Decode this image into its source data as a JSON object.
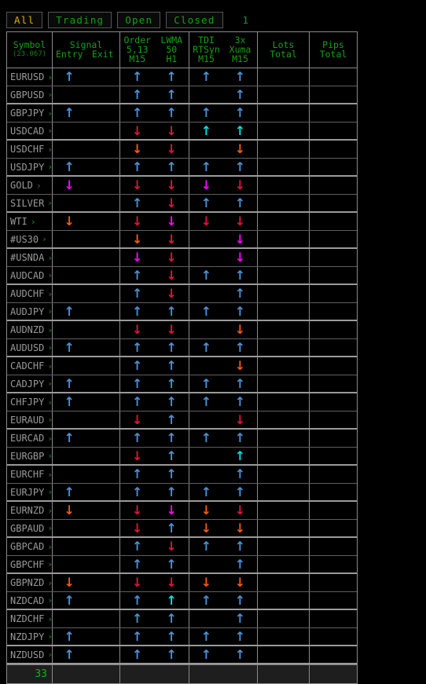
{
  "filters": {
    "buttons": [
      {
        "label": "All",
        "selected": true
      },
      {
        "label": "Trading",
        "selected": false
      },
      {
        "label": "Open",
        "selected": false
      },
      {
        "label": "Closed",
        "selected": false
      }
    ],
    "count": "1"
  },
  "colors": {
    "green": "#15a015",
    "yellow": "#d8b000",
    "symbol": "#9a9a9a",
    "up_blue": "#4a90d9",
    "up_cyan": "#00e0e0",
    "down_red": "#e2123f",
    "down_orange": "#f35a0a",
    "down_magenta": "#ff00ff",
    "border": "#8a8a8a",
    "background": "#000000",
    "footer_bg": "#1e1e1e"
  },
  "table": {
    "headers": [
      {
        "name": "symbol",
        "line1": "Symbol",
        "line2": "(23.067)"
      },
      {
        "name": "signal",
        "line1": "Signal",
        "sub_a": "Entry",
        "sub_b": "Exit"
      },
      {
        "name": "order-lwma",
        "a1": "Order",
        "a2": "5,13",
        "a3": "M15",
        "b1": "LWMA",
        "b2": "50",
        "b3": "H1"
      },
      {
        "name": "tdi-xuma",
        "a1": "TDI",
        "a2": "RTSyn",
        "a3": "M15",
        "b1": "3x",
        "b2": "Xuma",
        "b3": "M15"
      },
      {
        "name": "lots",
        "line1": "Lots",
        "line2": "Total"
      },
      {
        "name": "pips",
        "line1": "Pips",
        "line2": "Total"
      }
    ],
    "rows": [
      {
        "symbol": "EURUSD",
        "group_end": false,
        "signal_entry": "up-blue",
        "signal_exit": "",
        "order": "up-blue",
        "lwma": "up-blue",
        "tdi": "up-blue",
        "xuma": "up-blue",
        "lots": "",
        "pips": ""
      },
      {
        "symbol": "GBPUSD",
        "group_end": true,
        "signal_entry": "",
        "signal_exit": "",
        "order": "up-blue",
        "lwma": "up-blue",
        "tdi": "",
        "xuma": "up-blue",
        "lots": "",
        "pips": ""
      },
      {
        "symbol": "GBPJPY",
        "group_end": false,
        "signal_entry": "up-blue",
        "signal_exit": "",
        "order": "up-blue",
        "lwma": "up-blue",
        "tdi": "up-blue",
        "xuma": "up-blue",
        "lots": "",
        "pips": ""
      },
      {
        "symbol": "USDCAD",
        "group_end": true,
        "signal_entry": "",
        "signal_exit": "",
        "order": "down-red",
        "lwma": "down-red",
        "tdi": "up-cyan",
        "xuma": "up-cyan",
        "lots": "",
        "pips": ""
      },
      {
        "symbol": "USDCHF",
        "group_end": false,
        "signal_entry": "",
        "signal_exit": "",
        "order": "down-orange",
        "lwma": "down-red",
        "tdi": "",
        "xuma": "down-orange",
        "lots": "",
        "pips": ""
      },
      {
        "symbol": "USDJPY",
        "group_end": true,
        "signal_entry": "up-blue",
        "signal_exit": "",
        "order": "up-blue",
        "lwma": "up-blue",
        "tdi": "up-blue",
        "xuma": "up-blue",
        "lots": "",
        "pips": ""
      },
      {
        "symbol": "GOLD",
        "group_end": false,
        "signal_entry": "down-magenta",
        "signal_exit": "",
        "order": "down-red",
        "lwma": "down-red",
        "tdi": "down-magenta",
        "xuma": "down-red",
        "lots": "",
        "pips": ""
      },
      {
        "symbol": "SILVER",
        "group_end": true,
        "signal_entry": "",
        "signal_exit": "",
        "order": "up-blue",
        "lwma": "down-red",
        "tdi": "up-blue",
        "xuma": "up-blue",
        "lots": "",
        "pips": ""
      },
      {
        "symbol": "WTI",
        "group_end": false,
        "signal_entry": "down-orange",
        "signal_exit": "",
        "order": "down-red",
        "lwma": "down-magenta",
        "tdi": "down-red",
        "xuma": "down-red",
        "lots": "",
        "pips": ""
      },
      {
        "symbol": "#US30",
        "group_end": true,
        "signal_entry": "",
        "signal_exit": "",
        "order": "down-orange",
        "lwma": "down-red",
        "tdi": "",
        "xuma": "down-magenta",
        "lots": "",
        "pips": ""
      },
      {
        "symbol": "#USNDA",
        "group_end": false,
        "signal_entry": "",
        "signal_exit": "",
        "order": "down-magenta",
        "lwma": "down-red",
        "tdi": "",
        "xuma": "down-magenta",
        "lots": "",
        "pips": ""
      },
      {
        "symbol": "AUDCAD",
        "group_end": true,
        "signal_entry": "",
        "signal_exit": "",
        "order": "up-blue",
        "lwma": "down-red",
        "tdi": "up-blue",
        "xuma": "up-blue",
        "lots": "",
        "pips": ""
      },
      {
        "symbol": "AUDCHF",
        "group_end": false,
        "signal_entry": "",
        "signal_exit": "",
        "order": "up-blue",
        "lwma": "down-red",
        "tdi": "",
        "xuma": "up-blue",
        "lots": "",
        "pips": ""
      },
      {
        "symbol": "AUDJPY",
        "group_end": true,
        "signal_entry": "up-blue",
        "signal_exit": "",
        "order": "up-blue",
        "lwma": "up-blue",
        "tdi": "up-blue",
        "xuma": "up-blue",
        "lots": "",
        "pips": ""
      },
      {
        "symbol": "AUDNZD",
        "group_end": false,
        "signal_entry": "",
        "signal_exit": "",
        "order": "down-red",
        "lwma": "down-red",
        "tdi": "",
        "xuma": "down-orange",
        "lots": "",
        "pips": ""
      },
      {
        "symbol": "AUDUSD",
        "group_end": true,
        "signal_entry": "up-blue",
        "signal_exit": "",
        "order": "up-blue",
        "lwma": "up-blue",
        "tdi": "up-blue",
        "xuma": "up-blue",
        "lots": "",
        "pips": ""
      },
      {
        "symbol": "CADCHF",
        "group_end": false,
        "signal_entry": "",
        "signal_exit": "",
        "order": "up-blue",
        "lwma": "up-blue",
        "tdi": "",
        "xuma": "down-orange",
        "lots": "",
        "pips": ""
      },
      {
        "symbol": "CADJPY",
        "group_end": true,
        "signal_entry": "up-blue",
        "signal_exit": "",
        "order": "up-blue",
        "lwma": "up-blue",
        "tdi": "up-blue",
        "xuma": "up-blue",
        "lots": "",
        "pips": ""
      },
      {
        "symbol": "CHFJPY",
        "group_end": false,
        "signal_entry": "up-blue",
        "signal_exit": "",
        "order": "up-blue",
        "lwma": "up-blue",
        "tdi": "up-blue",
        "xuma": "up-blue",
        "lots": "",
        "pips": ""
      },
      {
        "symbol": "EURAUD",
        "group_end": true,
        "signal_entry": "",
        "signal_exit": "",
        "order": "down-red",
        "lwma": "up-blue",
        "tdi": "",
        "xuma": "down-red",
        "lots": "",
        "pips": ""
      },
      {
        "symbol": "EURCAD",
        "group_end": false,
        "signal_entry": "up-blue",
        "signal_exit": "",
        "order": "up-blue",
        "lwma": "up-blue",
        "tdi": "up-blue",
        "xuma": "up-blue",
        "lots": "",
        "pips": ""
      },
      {
        "symbol": "EURGBP",
        "group_end": true,
        "signal_entry": "",
        "signal_exit": "",
        "order": "down-red",
        "lwma": "up-blue",
        "tdi": "",
        "xuma": "up-cyan",
        "lots": "",
        "pips": ""
      },
      {
        "symbol": "EURCHF",
        "group_end": false,
        "signal_entry": "",
        "signal_exit": "",
        "order": "up-blue",
        "lwma": "up-blue",
        "tdi": "",
        "xuma": "up-blue",
        "lots": "",
        "pips": ""
      },
      {
        "symbol": "EURJPY",
        "group_end": true,
        "signal_entry": "up-blue",
        "signal_exit": "",
        "order": "up-blue",
        "lwma": "up-blue",
        "tdi": "up-blue",
        "xuma": "up-blue",
        "lots": "",
        "pips": ""
      },
      {
        "symbol": "EURNZD",
        "group_end": false,
        "signal_entry": "down-orange",
        "signal_exit": "",
        "order": "down-red",
        "lwma": "down-magenta",
        "tdi": "down-orange",
        "xuma": "down-red",
        "lots": "",
        "pips": ""
      },
      {
        "symbol": "GBPAUD",
        "group_end": true,
        "signal_entry": "",
        "signal_exit": "",
        "order": "down-red",
        "lwma": "up-blue",
        "tdi": "down-orange",
        "xuma": "down-orange",
        "lots": "",
        "pips": ""
      },
      {
        "symbol": "GBPCAD",
        "group_end": false,
        "signal_entry": "",
        "signal_exit": "",
        "order": "up-blue",
        "lwma": "down-red",
        "tdi": "up-blue",
        "xuma": "up-blue",
        "lots": "",
        "pips": ""
      },
      {
        "symbol": "GBPCHF",
        "group_end": true,
        "signal_entry": "",
        "signal_exit": "",
        "order": "up-blue",
        "lwma": "up-blue",
        "tdi": "",
        "xuma": "up-blue",
        "lots": "",
        "pips": ""
      },
      {
        "symbol": "GBPNZD",
        "group_end": false,
        "signal_entry": "down-orange",
        "signal_exit": "",
        "order": "down-red",
        "lwma": "down-red",
        "tdi": "down-orange",
        "xuma": "down-orange",
        "lots": "",
        "pips": ""
      },
      {
        "symbol": "NZDCAD",
        "group_end": true,
        "signal_entry": "up-blue",
        "signal_exit": "",
        "order": "up-blue",
        "lwma": "up-cyan",
        "tdi": "up-blue",
        "xuma": "up-blue",
        "lots": "",
        "pips": ""
      },
      {
        "symbol": "NZDCHF",
        "group_end": false,
        "signal_entry": "",
        "signal_exit": "",
        "order": "up-blue",
        "lwma": "up-blue",
        "tdi": "",
        "xuma": "up-blue",
        "lots": "",
        "pips": ""
      },
      {
        "symbol": "NZDJPY",
        "group_end": true,
        "signal_entry": "up-blue",
        "signal_exit": "",
        "order": "up-blue",
        "lwma": "up-blue",
        "tdi": "up-blue",
        "xuma": "up-blue",
        "lots": "",
        "pips": ""
      },
      {
        "symbol": "NZDUSD",
        "group_end": true,
        "signal_entry": "up-blue",
        "signal_exit": "",
        "order": "up-blue",
        "lwma": "up-blue",
        "tdi": "up-blue",
        "xuma": "up-blue",
        "lots": "",
        "pips": ""
      }
    ],
    "footer": {
      "symbol_total": "33",
      "signal": "",
      "order": "",
      "tdi": "",
      "lots": "",
      "pips": ""
    }
  }
}
